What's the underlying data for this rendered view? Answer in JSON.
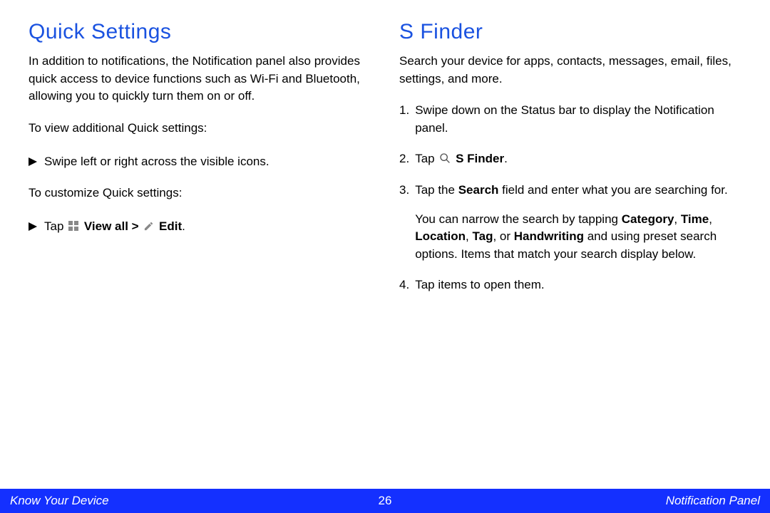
{
  "left": {
    "heading": "Quick Settings",
    "intro": "In addition to notifications, the Notification panel also provides quick access to device functions such as Wi-Fi and Bluetooth, allowing you to quickly turn them on or off.",
    "view_lead": "To view additional Quick settings:",
    "view_bullet": "Swipe left or right across the visible icons.",
    "customize_lead": "To customize Quick settings:",
    "customize_bullet_pre": "Tap ",
    "customize_viewall": "View all",
    "customize_gt": " > ",
    "customize_edit": "Edit",
    "customize_period": "."
  },
  "right": {
    "heading": "S Finder",
    "intro": "Search your device for apps, contacts, messages, email, files, settings, and more.",
    "step1": "Swipe down on the Status bar to display the Notification panel.",
    "step2_pre": "Tap ",
    "step2_bold": "S Finder",
    "step2_post": ".",
    "step3_pre": "Tap the ",
    "step3_bold1": "Search",
    "step3_post1": " field and enter what you are searching for.",
    "step3_para2_pre": "You can narrow the search by tapping ",
    "step3_b_cat": "Category",
    "step3_c1": ", ",
    "step3_b_time": "Time",
    "step3_c2": ", ",
    "step3_b_loc": "Location",
    "step3_c3": ", ",
    "step3_b_tag": "Tag",
    "step3_c4": ", or ",
    "step3_b_hand": "Handwriting",
    "step3_para2_post": " and using preset search options. Items that match your search display below.",
    "step4": "Tap items to open them."
  },
  "footer": {
    "left": "Know Your Device",
    "page": "26",
    "right": "Notification Panel"
  }
}
